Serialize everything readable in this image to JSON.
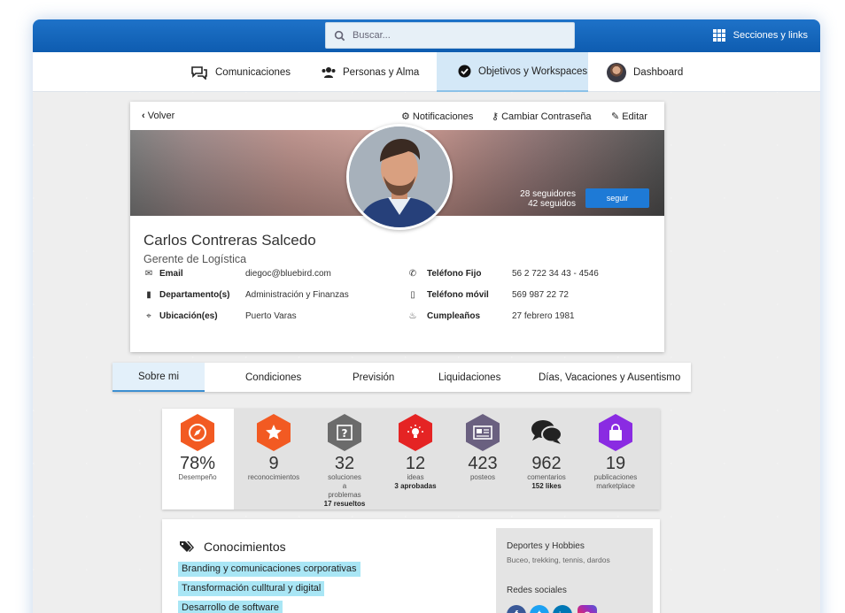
{
  "topbar": {
    "search_placeholder": "Buscar...",
    "sections_label": "Secciones y links",
    "brand_color": "#1468c0"
  },
  "nav": {
    "items": [
      {
        "label": "Comunicaciones",
        "icon": "chat-bubbles-icon"
      },
      {
        "label": "Personas y Alma",
        "icon": "users-icon"
      },
      {
        "label": "Objetivos y Workspaces",
        "icon": "check-circle-icon",
        "active": true
      },
      {
        "label": "Dashboard",
        "icon": "user-avatar"
      }
    ]
  },
  "profile": {
    "back_label": "Volver",
    "actions": {
      "notifications": "Notificaciones",
      "change_password": "Cambiar Contraseña",
      "edit": "Editar"
    },
    "followers": "28 seguidores",
    "following": "42 seguidos",
    "follow_button": "seguir",
    "name": "Carlos Contreras Salcedo",
    "role": "Gerente de Logística",
    "fields": {
      "email_label": "Email",
      "email_value": "diegoc@bluebird.com",
      "department_label": "Departamento(s)",
      "department_value": "Administración y Finanzas",
      "location_label": "Ubicación(es)",
      "location_value": "Puerto Varas",
      "phone_label": "Teléfono Fijo",
      "phone_value": "56 2 722 34 43 - 4546",
      "mobile_label": "Teléfono móvil",
      "mobile_value": "569 987 22 72",
      "birthday_label": "Cumpleaños",
      "birthday_value": "27 febrero 1981"
    }
  },
  "tabs": [
    "Sobre mi",
    "Condiciones",
    "Previsión",
    "Liquidaciones",
    "Días, Vacaciones y Ausentismo"
  ],
  "stats": [
    {
      "value": "78%",
      "label": "Desempeño",
      "sub": "",
      "color": "#f25a22",
      "icon": "compass-icon"
    },
    {
      "value": "9",
      "label": "reconocimientos",
      "sub": "",
      "color": "#f25a22",
      "icon": "star-icon"
    },
    {
      "value": "32",
      "label": "soluciones a problemas",
      "sub": "17 resueltos",
      "color": "#6b6b6b",
      "icon": "question-icon"
    },
    {
      "value": "12",
      "label": "ideas",
      "sub": "3 aprobadas",
      "color": "#e52424",
      "icon": "lightbulb-icon"
    },
    {
      "value": "423",
      "label": "posteos",
      "sub": "",
      "color": "#6a6080",
      "icon": "newspaper-icon"
    },
    {
      "value": "962",
      "label": "comentarios",
      "sub": "152 likes",
      "color": "#222222",
      "icon": "comments-icon"
    },
    {
      "value": "19",
      "label": "publicaciones marketplace",
      "sub": "",
      "color": "#8a2be2",
      "icon": "shopping-bag-icon"
    }
  ],
  "knowledge": {
    "title": "Conocimientos",
    "tags": [
      "Branding y comunicaciones corporativas",
      "Transformación culltural y digital",
      "Desarrollo de software"
    ],
    "hobbies_title": "Deportes y Hobbies",
    "hobbies_value": "Buceo, trekking, tennis, dardos",
    "social_title": "Redes sociales",
    "social": [
      {
        "name": "facebook-icon",
        "glyph": "f",
        "color": "#3b5998"
      },
      {
        "name": "twitter-icon",
        "glyph": "t",
        "color": "#1da1f2"
      },
      {
        "name": "linkedin-icon",
        "glyph": "in",
        "color": "#0077b5"
      },
      {
        "name": "instagram-icon",
        "glyph": "◎",
        "color": "#d62976"
      }
    ]
  }
}
